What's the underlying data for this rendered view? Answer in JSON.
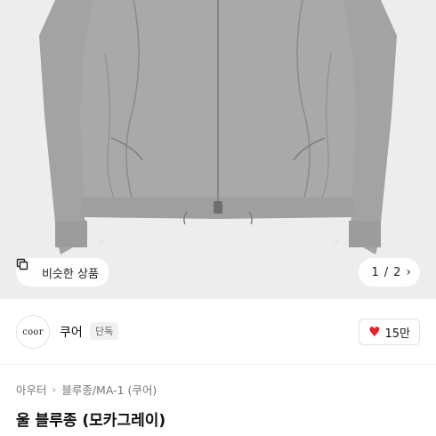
{
  "gallery": {
    "similar_label": "비슷한 상품",
    "page_current": "1",
    "page_separator": "/",
    "page_total": "2",
    "image_bg": "#ededed",
    "jacket_color": "#a9a9a9"
  },
  "seller": {
    "logo_text": "coor",
    "name": "쿠어",
    "badge": "단독",
    "likes": "15만"
  },
  "breadcrumb": {
    "category": "아우터",
    "subcategory": "블루종/MA-1 (쿠어)"
  },
  "product": {
    "title": "울 블루종 (모카그레이)"
  },
  "colors": {
    "heart": "#e8202b"
  }
}
